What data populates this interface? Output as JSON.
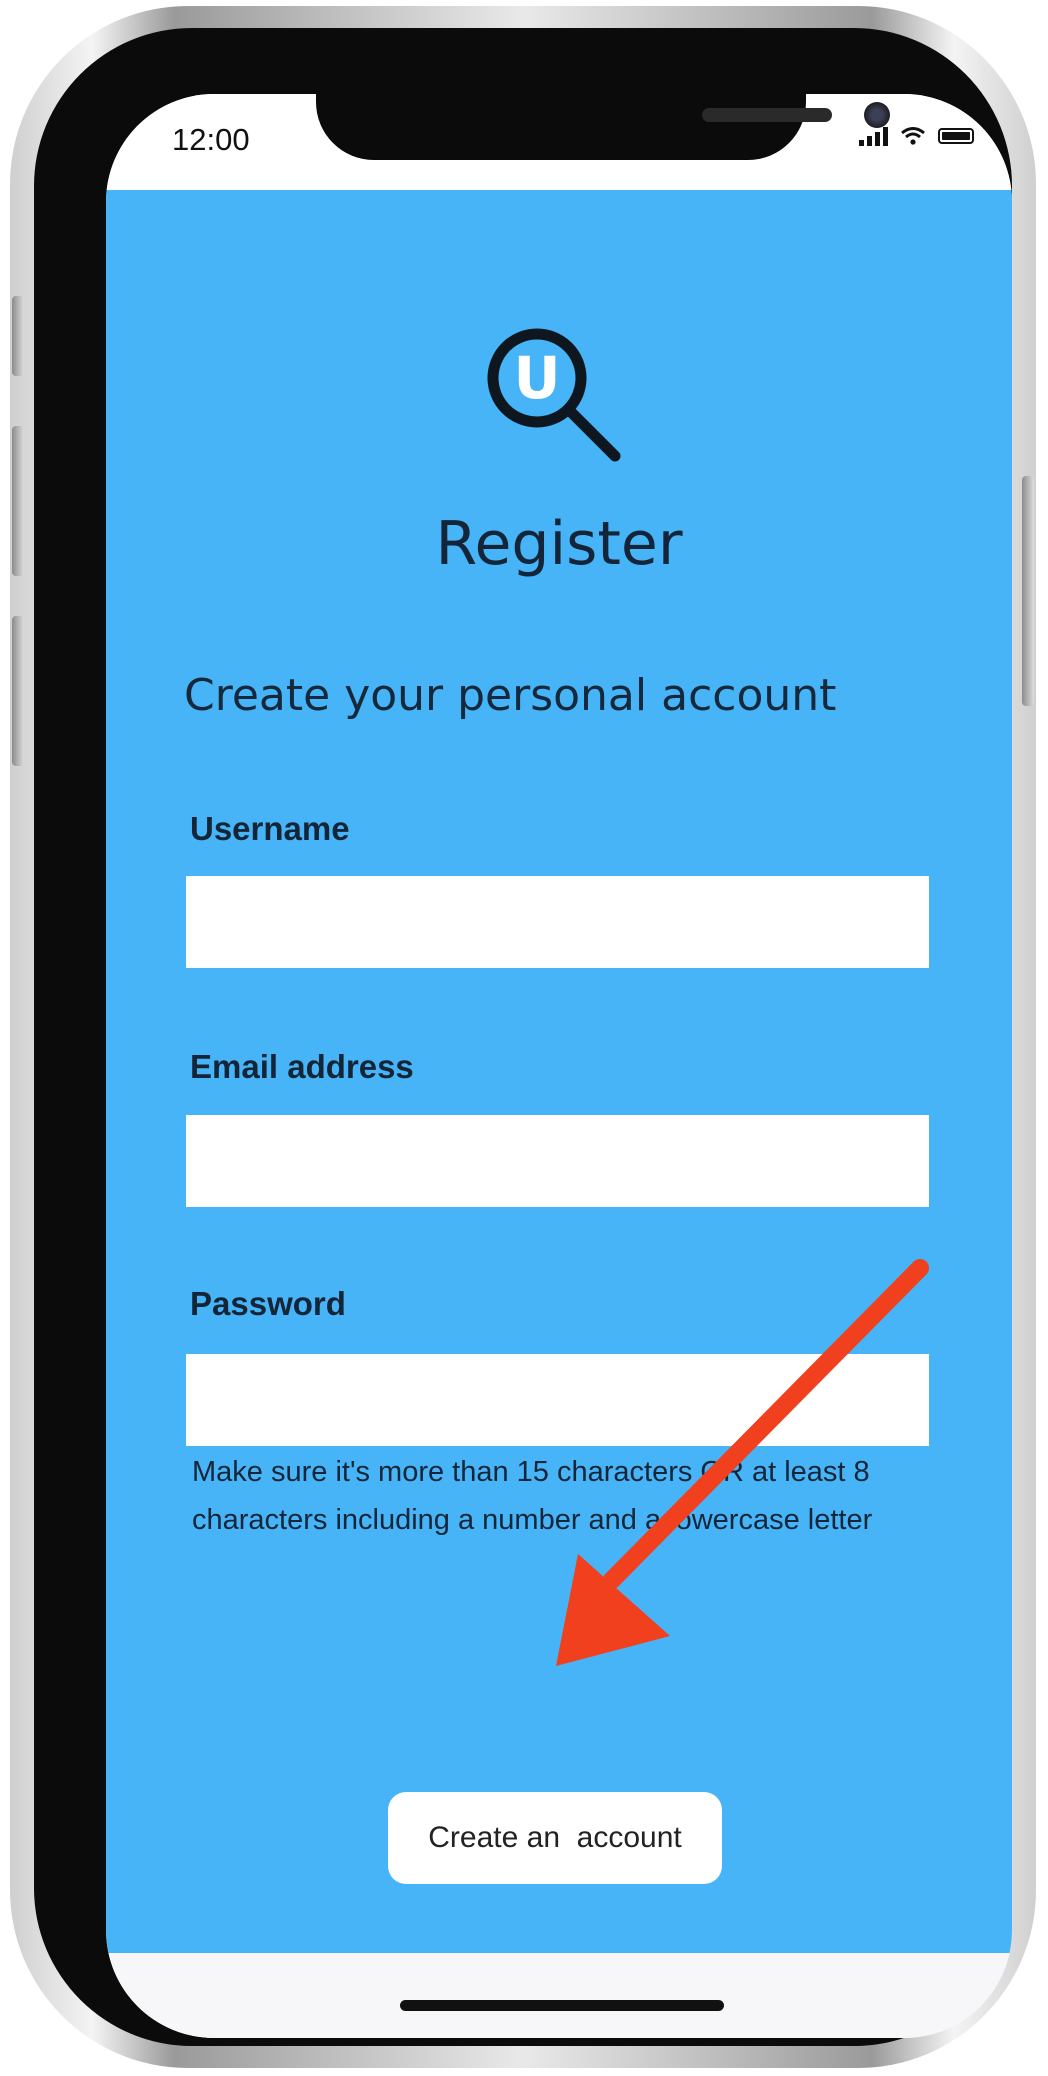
{
  "status_bar": {
    "time": "12:00",
    "icons": [
      "signal-icon",
      "wifi-icon",
      "battery-icon"
    ]
  },
  "logo": {
    "letter": "U",
    "icon": "magnifier-logo-icon"
  },
  "page": {
    "title": "Register",
    "subtitle": "Create your personal account"
  },
  "form": {
    "username": {
      "label": "Username",
      "value": ""
    },
    "email": {
      "label": "Email address",
      "value": ""
    },
    "password": {
      "label": "Password",
      "value": "",
      "hint": "Make sure it's more than 15 characters OR at least 8 characters including a number and a lowercase letter"
    },
    "submit_label": "Create an  account"
  },
  "colors": {
    "background": "#46b4f6",
    "annotation_arrow": "#f0401e",
    "text": "#14253a"
  }
}
